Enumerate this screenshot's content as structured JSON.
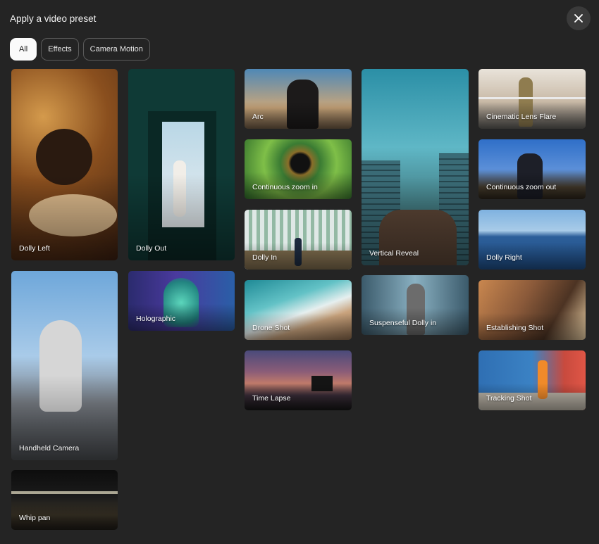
{
  "dialog": {
    "title": "Apply a video preset",
    "close_icon": "close-icon"
  },
  "filters": [
    {
      "label": "All",
      "selected": true
    },
    {
      "label": "Effects",
      "selected": false
    },
    {
      "label": "Camera Motion",
      "selected": false
    }
  ],
  "presets": {
    "dolly_left": "Dolly Left",
    "handheld_camera": "Handheld Camera",
    "whip_pan": "Whip pan",
    "dolly_out": "Dolly Out",
    "holographic": "Holographic",
    "arc": "Arc",
    "continuous_zoom_in": "Continuous zoom in",
    "dolly_in": "Dolly In",
    "drone_shot": "Drone Shot",
    "time_lapse": "Time Lapse",
    "vertical_reveal": "Vertical Reveal",
    "suspenseful_dolly_in": "Suspenseful Dolly in",
    "cinematic_lens_flare": "Cinematic Lens Flare",
    "continuous_zoom_out": "Continuous zoom out",
    "dolly_right": "Dolly Right",
    "establishing_shot": "Establishing Shot",
    "tracking_shot": "Tracking Shot"
  }
}
